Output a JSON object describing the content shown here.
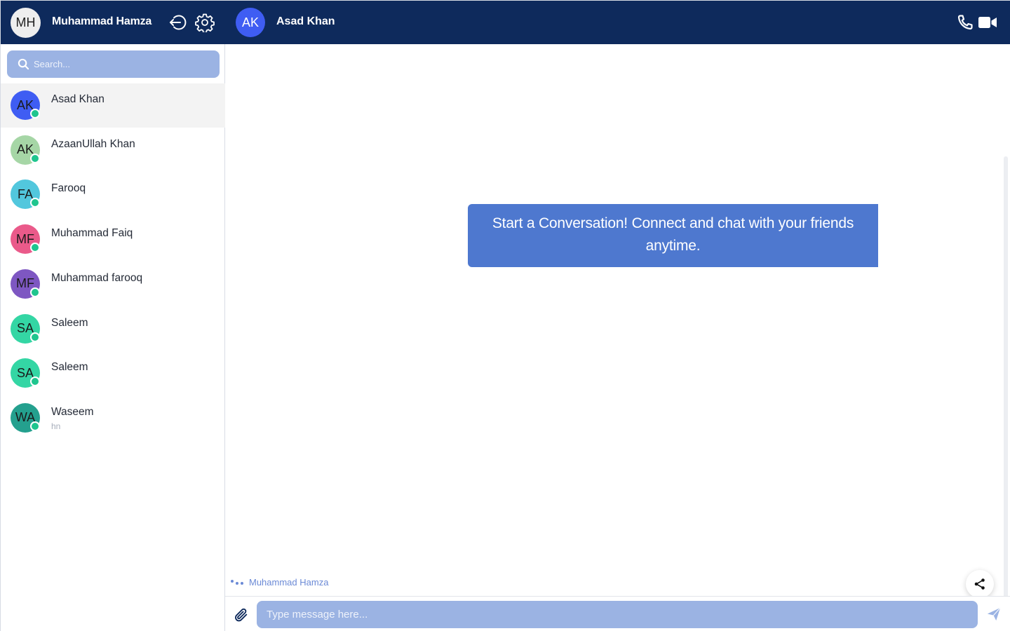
{
  "current_user": {
    "initials": "MH",
    "name": "Muhammad Hamza"
  },
  "search": {
    "placeholder": "Search..."
  },
  "contacts": [
    {
      "initials": "AK",
      "name": "Asad Khan",
      "last_message": "",
      "avatar_color": "#3f5df3",
      "online": true,
      "active": true
    },
    {
      "initials": "AK",
      "name": "AzaanUllah Khan",
      "last_message": "",
      "avatar_color": "#a6d6a6",
      "online": true,
      "active": false
    },
    {
      "initials": "FA",
      "name": "Farooq",
      "last_message": "",
      "avatar_color": "#52c7dd",
      "online": true,
      "active": false
    },
    {
      "initials": "MF",
      "name": "Muhammad Faiq",
      "last_message": "",
      "avatar_color": "#ea5a8a",
      "online": true,
      "active": false
    },
    {
      "initials": "MF",
      "name": "Muhammad farooq",
      "last_message": "",
      "avatar_color": "#7e57c2",
      "online": true,
      "active": false
    },
    {
      "initials": "SA",
      "name": "Saleem",
      "last_message": "",
      "avatar_color": "#34d6a4",
      "online": true,
      "active": false
    },
    {
      "initials": "SA",
      "name": "Saleem",
      "last_message": "",
      "avatar_color": "#34d6a4",
      "online": true,
      "active": false
    },
    {
      "initials": "WA",
      "name": "Waseem",
      "last_message": "hn",
      "avatar_color": "#24a08e",
      "online": true,
      "active": false
    }
  ],
  "chat": {
    "peer_initials": "AK",
    "peer_name": "Asad Khan",
    "welcome_message": "Start a Conversation! Connect and  chat with your friends anytime.",
    "typing_user": "Muhammad Hamza"
  },
  "composer": {
    "placeholder": "Type message here..."
  },
  "colors": {
    "header_bg": "#0e2a5c",
    "accent_light": "#9bb3e3",
    "bubble": "#4e78cf",
    "online": "#1fc58e"
  },
  "icons": {
    "logout": "logout-icon",
    "settings": "settings-icon",
    "search": "search-icon",
    "phone": "phone-icon",
    "video": "video-camera-icon",
    "share": "share-icon",
    "attach": "paperclip-icon",
    "send": "send-icon"
  }
}
